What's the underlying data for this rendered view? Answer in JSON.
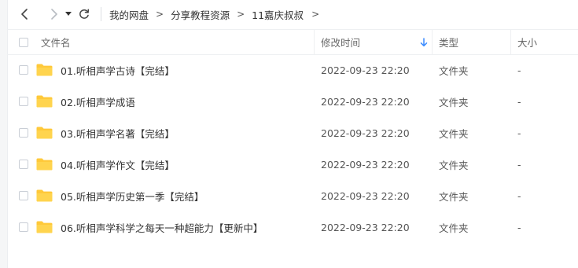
{
  "toolbar": {
    "back_icon": "chevron-left-icon",
    "forward_icon": "chevron-right-icon",
    "dropdown_icon": "caret-down-icon",
    "refresh_icon": "refresh-icon"
  },
  "breadcrumb": {
    "items": [
      "我的网盘",
      "分享教程资源",
      "11嘉庆叔叔"
    ],
    "separator": ">"
  },
  "table": {
    "columns": {
      "name": "文件名",
      "modified": "修改时间",
      "type": "类型",
      "size": "大小"
    },
    "sort_icon": "arrow-down-icon",
    "accent_color": "#3b8cff",
    "folder_color": "#ffc93a",
    "rows": [
      {
        "name": "01.听相声学古诗【完结】",
        "modified": "2022-09-23 22:20",
        "type": "文件夹",
        "size": "-"
      },
      {
        "name": "02.听相声学成语",
        "modified": "2022-09-23 22:20",
        "type": "文件夹",
        "size": "-"
      },
      {
        "name": "03.听相声学名著【完结】",
        "modified": "2022-09-23 22:20",
        "type": "文件夹",
        "size": "-"
      },
      {
        "name": "04.听相声学作文【完结】",
        "modified": "2022-09-23 22:20",
        "type": "文件夹",
        "size": "-"
      },
      {
        "name": "05.听相声学历史第一季【完结】",
        "modified": "2022-09-23 22:20",
        "type": "文件夹",
        "size": "-"
      },
      {
        "name": "06.听相声学科学之每天一种超能力【更新中】",
        "modified": "2022-09-23 22:20",
        "type": "文件夹",
        "size": "-"
      }
    ]
  }
}
